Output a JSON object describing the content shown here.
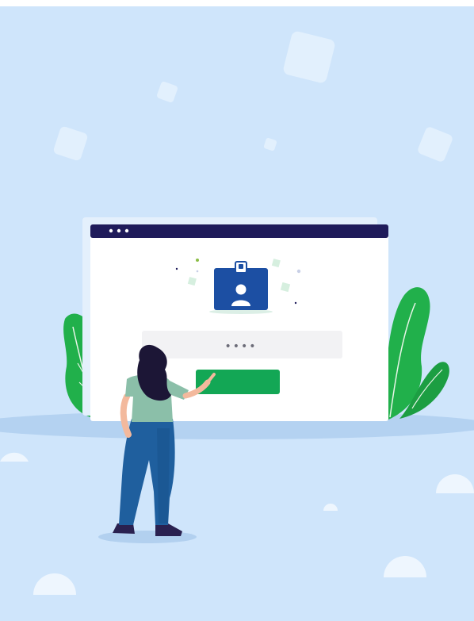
{
  "login_illustration": {
    "password_mask": "••••",
    "login_button_label": ""
  },
  "colors": {
    "background": "#cfe5fb",
    "browser_titlebar": "#1f1b5a",
    "button_green": "#13a755",
    "badge_blue": "#1c4fa3",
    "leaf_green": "#21b04b",
    "skin": "#f3b99d",
    "shirt": "#8bbfa9",
    "jeans": "#1f5f9e",
    "hair": "#1c1636"
  },
  "icons": [
    "id-badge-icon",
    "user-icon"
  ]
}
